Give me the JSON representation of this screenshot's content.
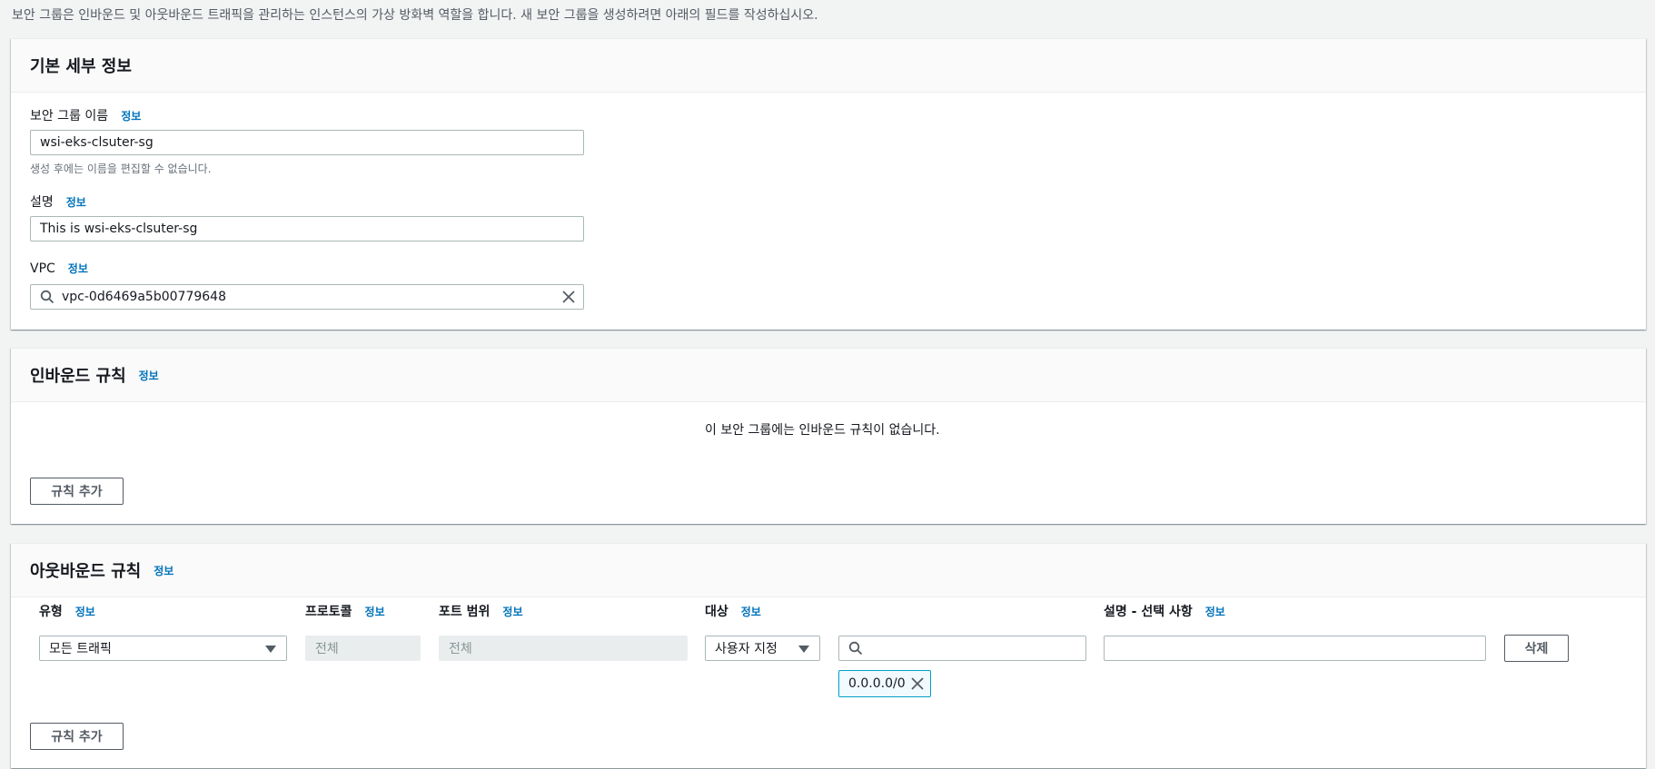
{
  "intro": "보안 그룹은 인바운드 및 아웃바운드 트래픽을 관리하는 인스턴스의 가상 방화벽 역할을 합니다. 새 보안 그룹을 생성하려면 아래의 필드를 작성하십시오.",
  "info_label": "정보",
  "basic": {
    "title": "기본 세부 정보",
    "name_label": "보안 그룹 이름",
    "name_value": "wsi-eks-clsuter-sg",
    "name_hint": "생성 후에는 이름을 편집할 수 없습니다.",
    "desc_label": "설명",
    "desc_value": "This is wsi-eks-clsuter-sg",
    "vpc_label": "VPC",
    "vpc_value": "vpc-0d6469a5b00779648"
  },
  "inbound": {
    "title": "인바운드 규칙",
    "empty_message": "이 보안 그룹에는 인바운드 규칙이 없습니다.",
    "add_rule": "규칙 추가"
  },
  "outbound": {
    "title": "아웃바운드 규칙",
    "columns": {
      "type": "유형",
      "protocol": "프로토콜",
      "port_range": "포트 범위",
      "destination": "대상",
      "description": "설명 - 선택 사항"
    },
    "rule": {
      "type": "모든 트래픽",
      "protocol": "전체",
      "port_range": "전체",
      "destination_type": "사용자 지정",
      "search_value": "",
      "description_value": "",
      "cidr_token": "0.0.0.0/0",
      "delete": "삭제"
    },
    "add_rule": "규칙 추가"
  }
}
